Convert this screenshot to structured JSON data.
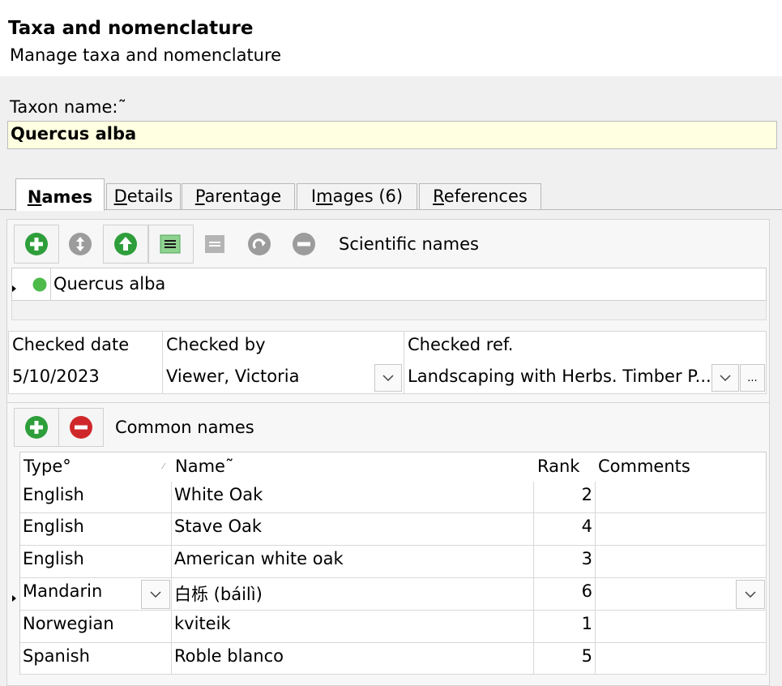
{
  "header": {
    "title": "Taxa and nomenclature",
    "subtitle": "Manage taxa and nomenclature"
  },
  "taxon": {
    "label": "Taxon name:˜",
    "value": "Quercus alba"
  },
  "tabs": [
    {
      "label_pre": "",
      "label_u": "N",
      "label_post": "ames",
      "active": true
    },
    {
      "label_pre": "",
      "label_u": "D",
      "label_post": "etails",
      "active": false
    },
    {
      "label_pre": "",
      "label_u": "P",
      "label_post": "arentage",
      "active": false
    },
    {
      "label_pre": "I",
      "label_u": "m",
      "label_post": "ages (6)",
      "active": false
    },
    {
      "label_pre": "",
      "label_u": "R",
      "label_post": "eferences",
      "active": false
    }
  ],
  "scientific": {
    "label": "Scientific names",
    "names": [
      {
        "name": "Quercus alba"
      }
    ]
  },
  "checked": {
    "headers": {
      "date": "Checked date",
      "by": "Checked by",
      "ref": "Checked ref."
    },
    "values": {
      "date": "5/10/2023",
      "by": "Viewer, Victoria",
      "ref": "Landscaping with Herbs. Timber P..."
    },
    "more_label": "..."
  },
  "common": {
    "label": "Common names",
    "columns": {
      "type": "Type°",
      "name": "Name˜",
      "rank": "Rank",
      "comments": "Comments"
    },
    "rows": [
      {
        "type": "English",
        "name": "White Oak",
        "rank": "2",
        "comments": ""
      },
      {
        "type": "English",
        "name": "Stave Oak",
        "rank": "4",
        "comments": ""
      },
      {
        "type": "English",
        "name": "American white oak",
        "rank": "3",
        "comments": ""
      },
      {
        "type": "Mandarin",
        "name": "白栎 (báilì)",
        "rank": "6",
        "comments": ""
      },
      {
        "type": "Norwegian",
        "name": "kviteik",
        "rank": "1",
        "comments": ""
      },
      {
        "type": "Spanish",
        "name": "Roble blanco",
        "rank": "5",
        "comments": ""
      }
    ]
  },
  "colors": {
    "accent_green": "#2e9e3b",
    "remove_red": "#d0282a",
    "disabled_gray": "#9c9c9c",
    "taxon_field_bg": "#ffffe1",
    "status_dot": "#4cbb4a"
  }
}
